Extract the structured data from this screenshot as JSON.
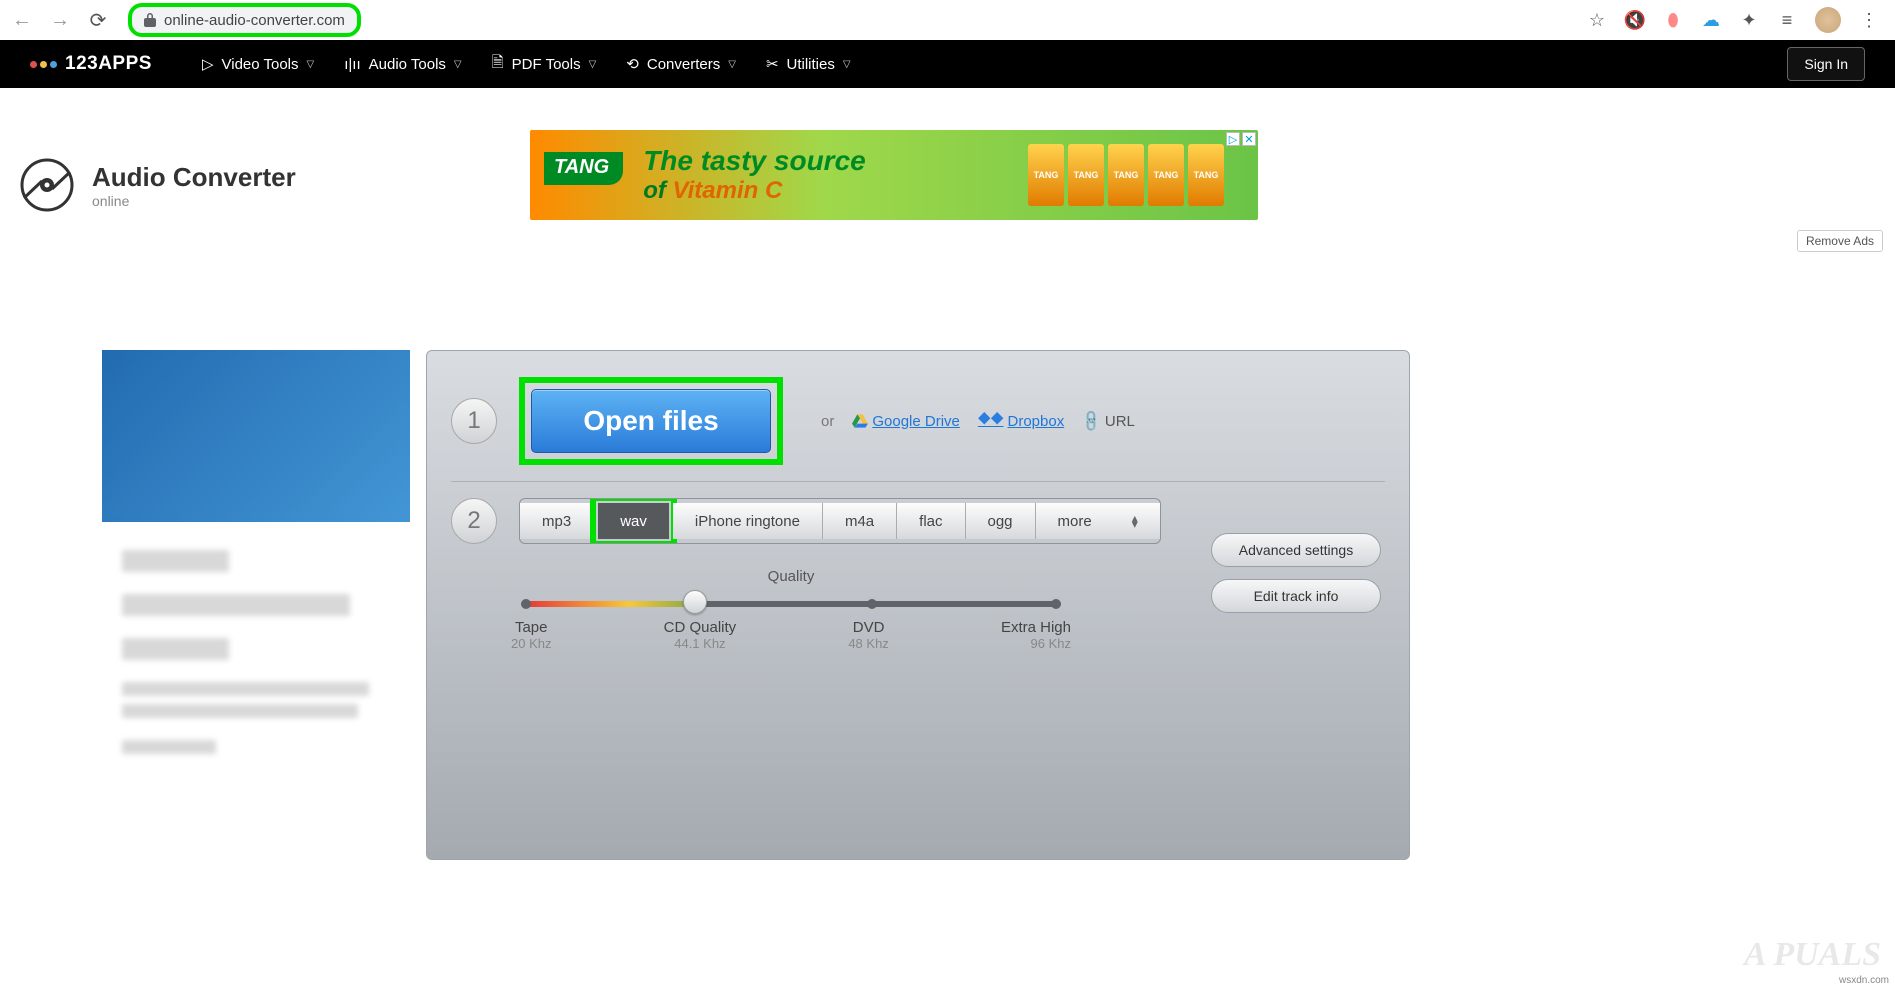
{
  "browser": {
    "url": "online-audio-converter.com"
  },
  "nav": {
    "brand": "123APPS",
    "items": [
      "Video Tools",
      "Audio Tools",
      "PDF Tools",
      "Converters",
      "Utilities"
    ],
    "signin": "Sign In"
  },
  "app": {
    "title": "Audio Converter",
    "subtitle": "online"
  },
  "ad": {
    "brand": "TANG",
    "line1": "The tasty source",
    "line2_a": "of ",
    "line2_b": "Vitamin C",
    "pack_labels": [
      "TANG",
      "TANG",
      "TANG",
      "TANG",
      "TANG"
    ]
  },
  "remove_ads": "Remove Ads",
  "step1": {
    "num": "1",
    "open": "Open files",
    "or": "or",
    "gdrive": "Google Drive",
    "dropbox": "Dropbox",
    "url": "URL"
  },
  "step2": {
    "num": "2",
    "formats": [
      "mp3",
      "wav",
      "iPhone ringtone",
      "m4a",
      "flac",
      "ogg",
      "more"
    ],
    "active": "wav"
  },
  "quality": {
    "title": "Quality",
    "labels": [
      {
        "t": "Tape",
        "s": "20 Khz"
      },
      {
        "t": "CD Quality",
        "s": "44.1 Khz"
      },
      {
        "t": "DVD",
        "s": "48 Khz"
      },
      {
        "t": "Extra High",
        "s": "96 Khz"
      }
    ]
  },
  "buttons": {
    "advanced": "Advanced settings",
    "trackinfo": "Edit track info"
  },
  "watermark": "A PUALS",
  "credit": "wsxdn.com"
}
